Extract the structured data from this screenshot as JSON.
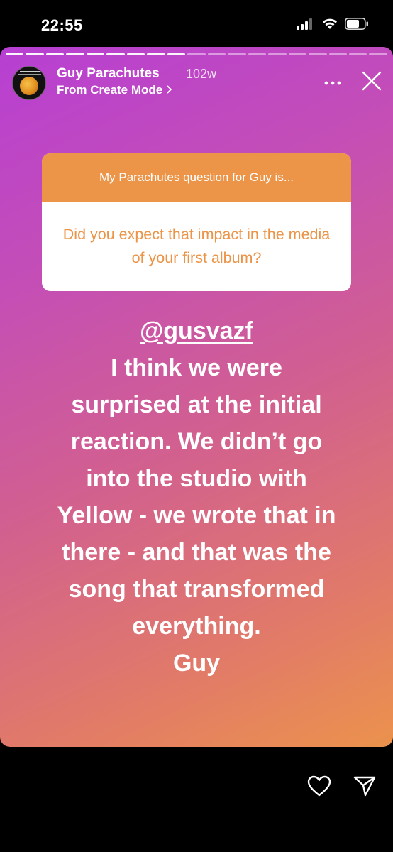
{
  "status_bar": {
    "time": "22:55",
    "icons": [
      "signal-icon",
      "wifi-icon",
      "battery-icon"
    ]
  },
  "story": {
    "progress": {
      "total_segments": 19,
      "completed_segments": 9
    },
    "header": {
      "username": "Guy Parachutes",
      "time_ago": "102w",
      "subtitle": "From Create Mode",
      "subtitle_icon": "chevron-right-icon",
      "more_icon": "more-horizontal-icon",
      "close_icon": "close-icon"
    },
    "question_card": {
      "header": "My Parachutes question for Guy is...",
      "question": "Did you expect that impact in the media of your first album?",
      "header_color": "#ec9447",
      "text_color": "#eb9448"
    },
    "answer": {
      "mention": "@gusvazf",
      "lines": [
        "I think we were",
        "surprised at the initial",
        "reaction. We didn’t go",
        "into the studio with",
        "Yellow - we wrote that in",
        "there - and that was the",
        "song that transformed",
        "everything.",
        "Guy"
      ]
    }
  },
  "actions": {
    "like_icon": "heart-icon",
    "share_icon": "send-icon"
  },
  "colors": {
    "gradient_start": "#b73fd3",
    "gradient_end": "#eb924d"
  }
}
